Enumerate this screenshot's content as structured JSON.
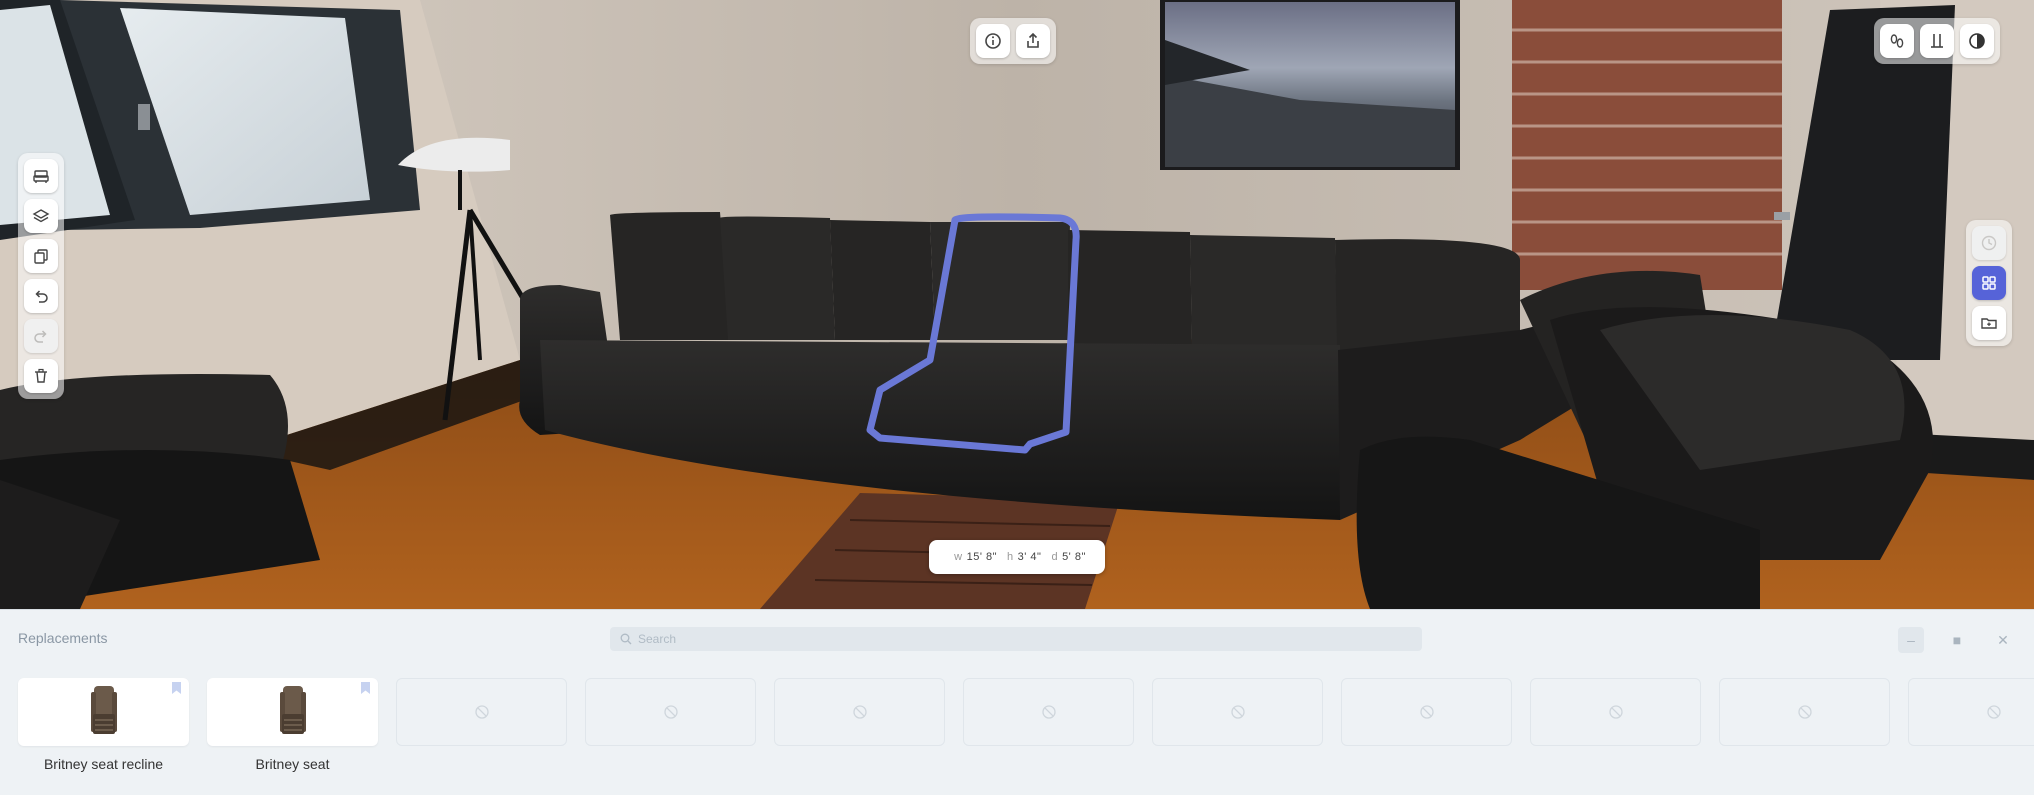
{
  "toolbar_top": {
    "info_icon": "info-icon",
    "share_icon": "share-icon"
  },
  "toolbar_top_right": {
    "items": [
      "shoe-prints-icon",
      "ruler-icon",
      "contrast-icon"
    ]
  },
  "toolbar_left": {
    "items": [
      "furniture-icon",
      "layers-icon",
      "duplicate-icon",
      "undo-icon",
      "redo-icon",
      "delete-icon"
    ]
  },
  "toolbar_right": {
    "items": [
      "clock-icon",
      "grid-icon",
      "folder-icon"
    ]
  },
  "dimensions": {
    "w_key": "w",
    "w_value": "15' 8\"",
    "h_key": "h",
    "h_value": "3' 4\"",
    "d_key": "d",
    "d_value": "5' 8\""
  },
  "colors": {
    "accent": "#5663d8",
    "selection_outline": "#6a78d6"
  },
  "replacements": {
    "title": "Replacements",
    "search_placeholder": "Search",
    "items": [
      {
        "label": "Britney seat recline",
        "has_product": true
      },
      {
        "label": "Britney seat",
        "has_product": true
      },
      {
        "label": "",
        "has_product": false
      },
      {
        "label": "",
        "has_product": false
      },
      {
        "label": "",
        "has_product": false
      },
      {
        "label": "",
        "has_product": false
      },
      {
        "label": "",
        "has_product": false
      },
      {
        "label": "",
        "has_product": false
      },
      {
        "label": "",
        "has_product": false
      },
      {
        "label": "",
        "has_product": false
      },
      {
        "label": "",
        "has_product": false
      }
    ]
  }
}
